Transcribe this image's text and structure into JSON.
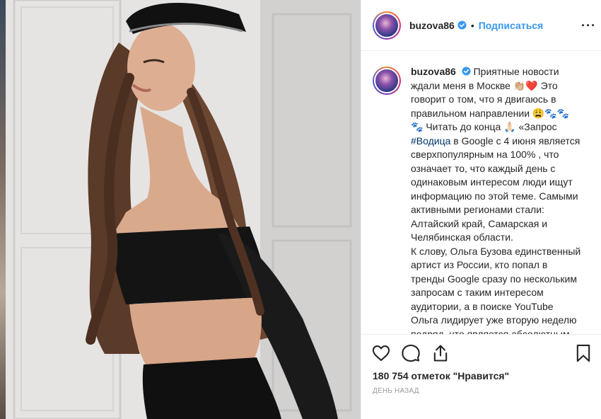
{
  "post": {
    "username": "buzova86",
    "dot": "•",
    "follow_label": "Подписаться",
    "more_label": "···",
    "caption": {
      "username": "buzova86",
      "lines": [
        "Приятные новости",
        "ждали меня в Москве 👏🏼❤️ Это",
        "говорит о том, что я двигаюсь в",
        "правильном направлении 😩🐾🐾",
        "🐾 Читать до конца 🙏🏻 «Запрос",
        "в Google с 4 июня является",
        "сверхпопулярным на 100% , что",
        "означает то, что каждый день с",
        "одинаковым интересом люди ищут",
        "информацию по этой теме. Самыми",
        "активными регионами стали:",
        "Алтайский край, Самарская и",
        "Челябинская области.",
        "К слову, Ольга Бузова единственный",
        "артист из России, кто попал в",
        "тренды Google сразу по нескольким",
        "запросам с таким интересом",
        "аудитории, а в поиске YouTube",
        "Ольга лидирует уже вторую неделю",
        "подряд, что является абсолютным"
      ],
      "hashtag": "#Водица"
    },
    "likes_text": "180 754 отметок \"Нравится\"",
    "time_text": "ДЕНЬ НАЗАД"
  },
  "icons": {
    "like": "heart-icon",
    "comment": "comment-icon",
    "share": "share-icon",
    "save": "bookmark-icon",
    "verified": "verified-badge-icon"
  },
  "colors": {
    "link": "#3897f0",
    "text": "#262626",
    "muted": "#999999",
    "hashtag": "#003569"
  }
}
